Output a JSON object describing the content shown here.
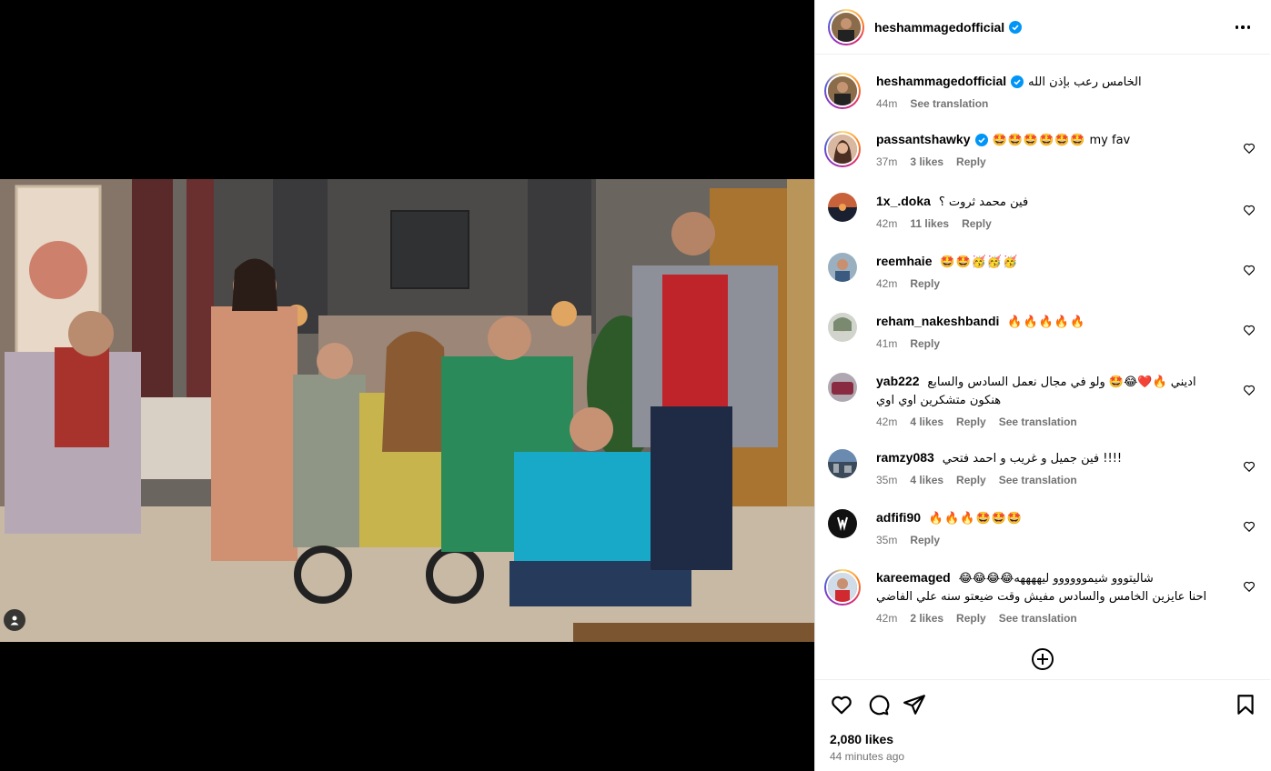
{
  "post": {
    "username": "heshammagedofficial",
    "caption": "الخامس رعب بإذن الله",
    "caption_time": "44m",
    "see_translation": "See translation"
  },
  "comments": [
    {
      "user": "passantshawky",
      "verified": true,
      "text": "my fav",
      "emoji": "🤩🤩🤩🤩🤩🤩",
      "time": "37m",
      "likes": "3 likes",
      "reply": "Reply",
      "translation": ""
    },
    {
      "user": "1x_.doka",
      "verified": false,
      "text": "فين محمد ثروت ؟",
      "emoji": "",
      "time": "42m",
      "likes": "11 likes",
      "reply": "Reply",
      "translation": ""
    },
    {
      "user": "reemhaie",
      "verified": false,
      "text": "",
      "emoji": "🤩🤩🥳🥳🥳",
      "time": "42m",
      "likes": "",
      "reply": "Reply",
      "translation": ""
    },
    {
      "user": "reham_nakeshbandi",
      "verified": false,
      "text": "",
      "emoji": "🔥🔥🔥🔥🔥",
      "time": "41m",
      "likes": "",
      "reply": "Reply",
      "translation": ""
    },
    {
      "user": "yab222",
      "verified": false,
      "text": "اديني 🔥❤️😂🤩 ولو في مجال نعمل السادس والسابع",
      "text2": "هنكون متشكرين اوي اوي",
      "emoji": "",
      "time": "42m",
      "likes": "4 likes",
      "reply": "Reply",
      "translation": "See translation"
    },
    {
      "user": "ramzy083",
      "verified": false,
      "text": "فين جميل و غريب و احمد فتحي !!!!",
      "emoji": "",
      "time": "35m",
      "likes": "4 likes",
      "reply": "Reply",
      "translation": "See translation"
    },
    {
      "user": "adfifi90",
      "verified": false,
      "text": "",
      "emoji": "🔥🔥🔥🤩🤩🤩",
      "time": "35m",
      "likes": "",
      "reply": "Reply",
      "translation": ""
    },
    {
      "user": "kareemaged",
      "verified": false,
      "text": "😂😂😂😂شاليتووو شيموووووو ليههههه",
      "text2": "احنا عايزين الخامس والسادس مفيش وقت ضيعتو سنه علي الفاضي",
      "emoji": "",
      "time": "42m",
      "likes": "2 likes",
      "reply": "Reply",
      "translation": "See translation"
    }
  ],
  "footer": {
    "likes": "2,080 likes",
    "time": "44 minutes ago"
  },
  "icons": {
    "more": "more-options-icon",
    "like": "heart-icon",
    "comment": "comment-icon",
    "share": "share-icon",
    "save": "bookmark-icon",
    "load": "plus-circle-icon",
    "tag": "user-tag-icon",
    "verified": "verified-badge-icon"
  },
  "colors": {
    "verified": "#0095f6",
    "meta": "#737373",
    "divider": "#efefef"
  }
}
